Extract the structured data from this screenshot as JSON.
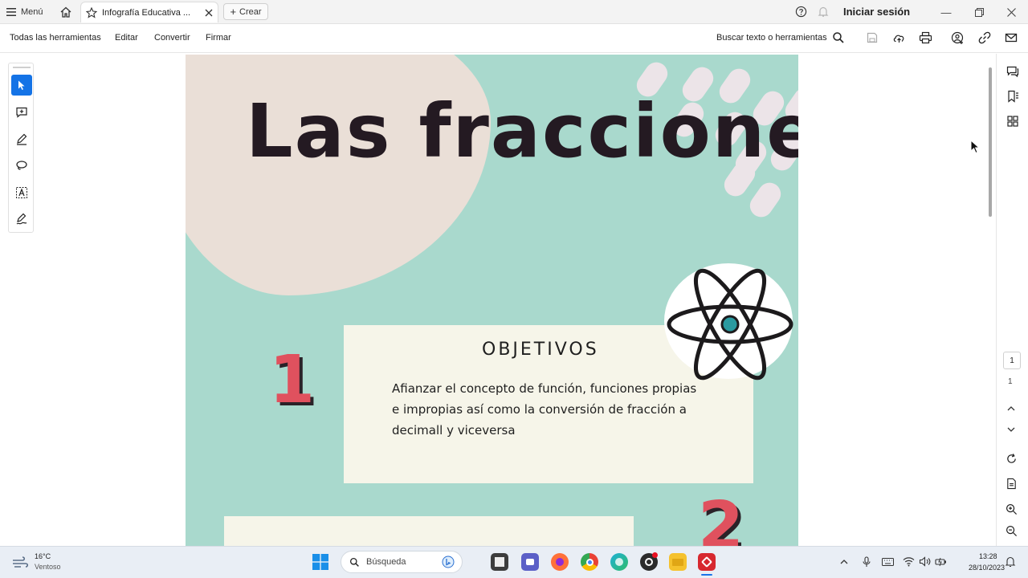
{
  "titlebar": {
    "menu_label": "Menú",
    "tab_title": "Infografía Educativa ...",
    "new_tab_label": "Crear",
    "signin_label": "Iniciar sesión"
  },
  "toolbar": {
    "menu_items": [
      "Todas las herramientas",
      "Editar",
      "Convertir",
      "Firmar"
    ],
    "search_label": "Buscar texto o herramientas"
  },
  "document": {
    "title": "Las fracciones",
    "card": {
      "heading": "OBJETIVOS",
      "body": "Afianzar el concepto de función, funciones propias e impropias así como la conversión de fracción a decimall y viceversa"
    },
    "numbers": [
      "1",
      "2"
    ]
  },
  "navigation": {
    "current_page": "1",
    "total_pages": "1"
  },
  "taskbar": {
    "weather_temp": "16°C",
    "weather_desc": "Ventoso",
    "search_placeholder": "Búsqueda",
    "time": "13:28",
    "date": "28/10/2023"
  },
  "colors": {
    "accent": "#1473e6",
    "page_background": "#a9d9cd",
    "blob": "#eadfd7",
    "card": "#f6f5e9",
    "number": "#e0515e",
    "acrobat_red": "#d7282f"
  }
}
